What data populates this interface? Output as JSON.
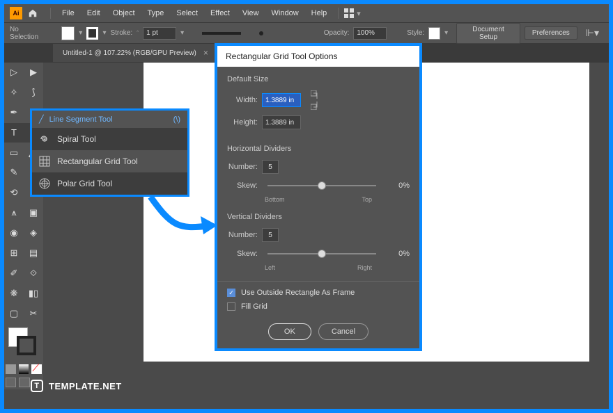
{
  "menu": [
    "File",
    "Edit",
    "Object",
    "Type",
    "Select",
    "Effect",
    "View",
    "Window",
    "Help"
  ],
  "controlbar": {
    "selection": "No Selection",
    "stroke_label": "Stroke:",
    "stroke_val": "1 pt",
    "opacity_label": "Opacity:",
    "opacity_val": "100%",
    "style_label": "Style:",
    "doc_setup": "Document Setup",
    "prefs": "Preferences"
  },
  "tab": {
    "title": "Untitled-1 @ 107.22% (RGB/GPU Preview)",
    "close": "×"
  },
  "flyout": {
    "header": "Line Segment Tool",
    "shortcut": "(\\)",
    "items": [
      {
        "label": "Spiral Tool",
        "selected": false
      },
      {
        "label": "Rectangular Grid Tool",
        "selected": true
      },
      {
        "label": "Polar Grid Tool",
        "selected": false
      }
    ]
  },
  "dialog": {
    "title": "Rectangular Grid Tool Options",
    "default_size": "Default Size",
    "width_label": "Width:",
    "width_val": "1.3889 in",
    "height_label": "Height:",
    "height_val": "1.3889 in",
    "h_div": "Horizontal Dividers",
    "number_label": "Number:",
    "h_num": "5",
    "skew_label": "Skew:",
    "h_skew": "0%",
    "h_left": "Bottom",
    "h_right": "Top",
    "v_div": "Vertical Dividers",
    "v_num": "5",
    "v_skew": "0%",
    "v_left": "Left",
    "v_right": "Right",
    "chk_frame": "Use Outside Rectangle As Frame",
    "chk_fill": "Fill Grid",
    "ok": "OK",
    "cancel": "Cancel"
  },
  "watermark": "TEMPLATE.NET"
}
